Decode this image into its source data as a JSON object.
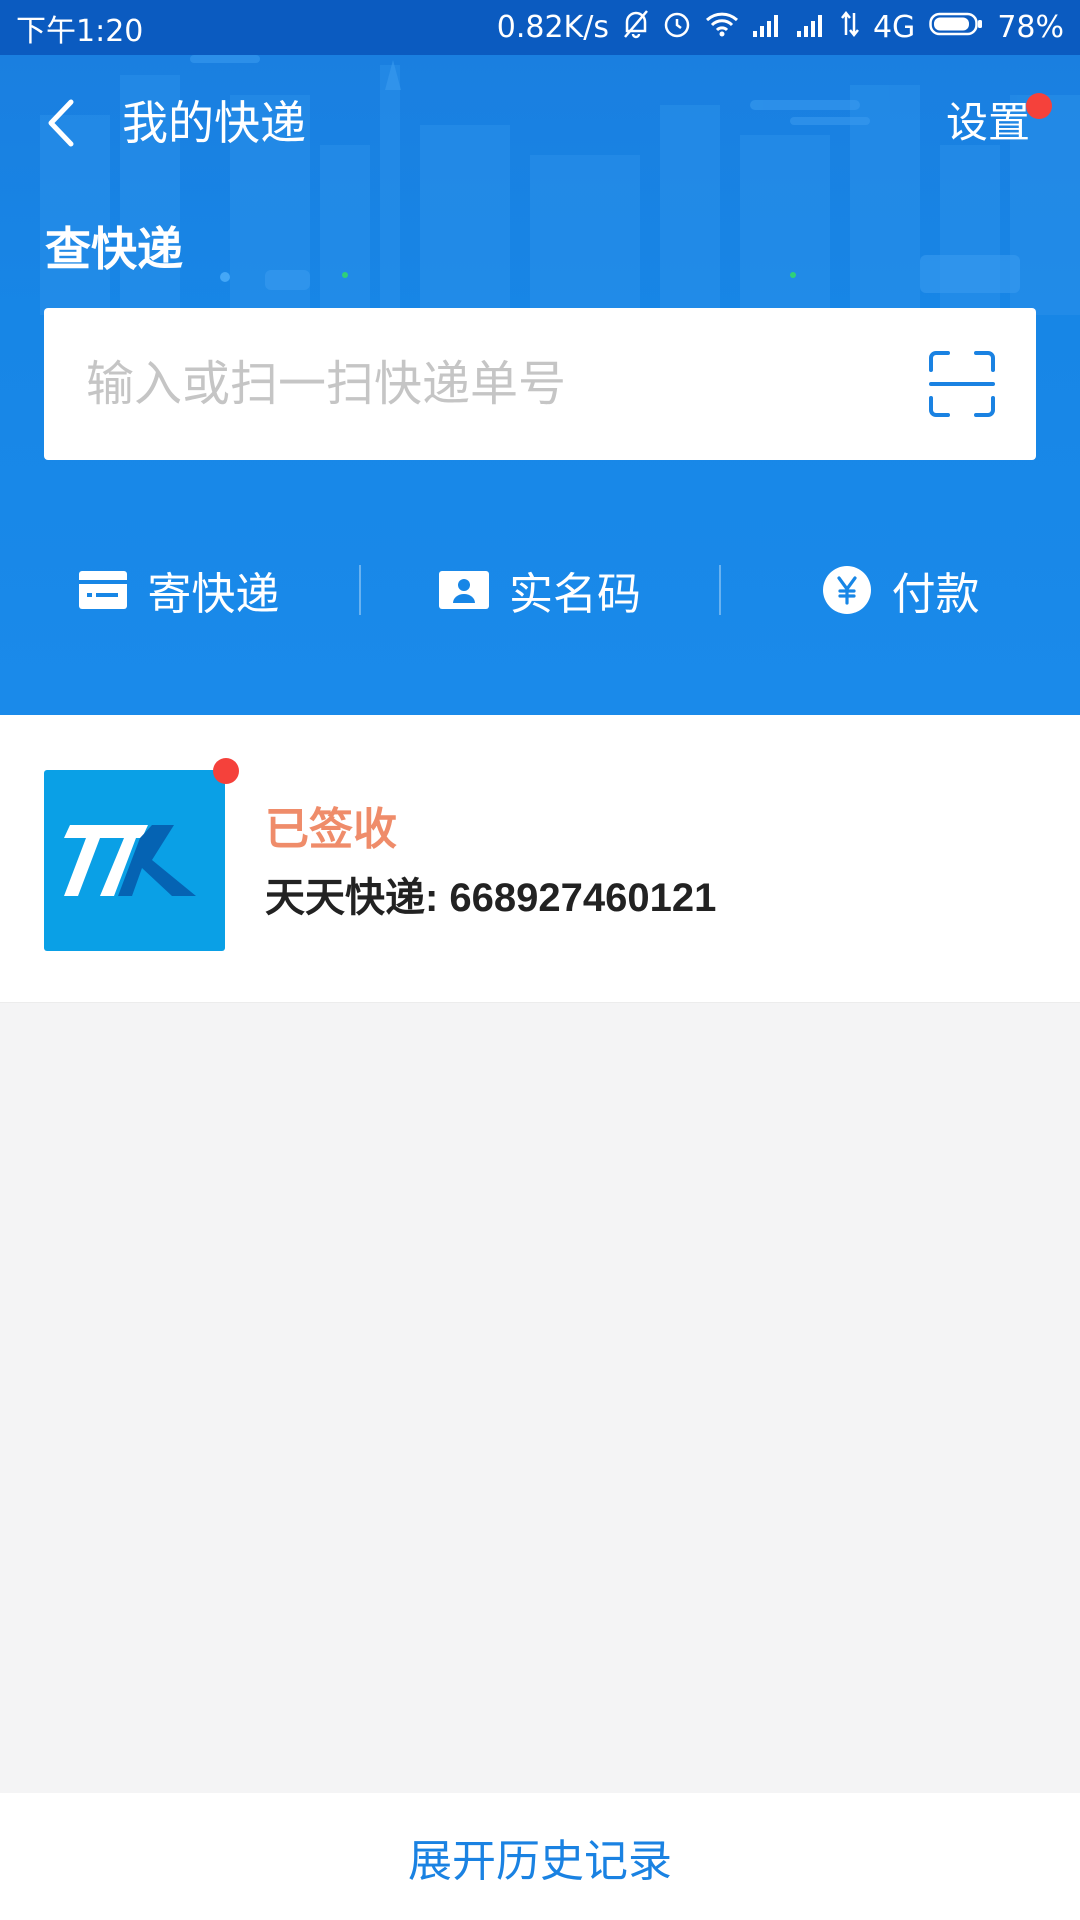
{
  "status_bar": {
    "time": "下午1:20",
    "net_speed": "0.82K/s",
    "network": "4G",
    "battery": "78%"
  },
  "nav": {
    "title": "我的快递",
    "settings": "设置"
  },
  "section": {
    "title": "查快递"
  },
  "search": {
    "placeholder": "输入或扫一扫快递单号"
  },
  "actions": [
    {
      "label": "寄快递",
      "icon": "send-package-icon"
    },
    {
      "label": "实名码",
      "icon": "id-card-icon"
    },
    {
      "label": "付款",
      "icon": "yuan-icon"
    }
  ],
  "package": {
    "status": "已签收",
    "number": "天天快递: 668927460121",
    "company_logo_text": "TTK"
  },
  "footer": {
    "expand": "展开历史记录"
  },
  "colors": {
    "header_blue": "#1786e6",
    "status_orange": "#ef8c6a",
    "badge_red": "#f5413b",
    "logo_blue": "#0aa0e6",
    "link_blue": "#1a82e2"
  }
}
